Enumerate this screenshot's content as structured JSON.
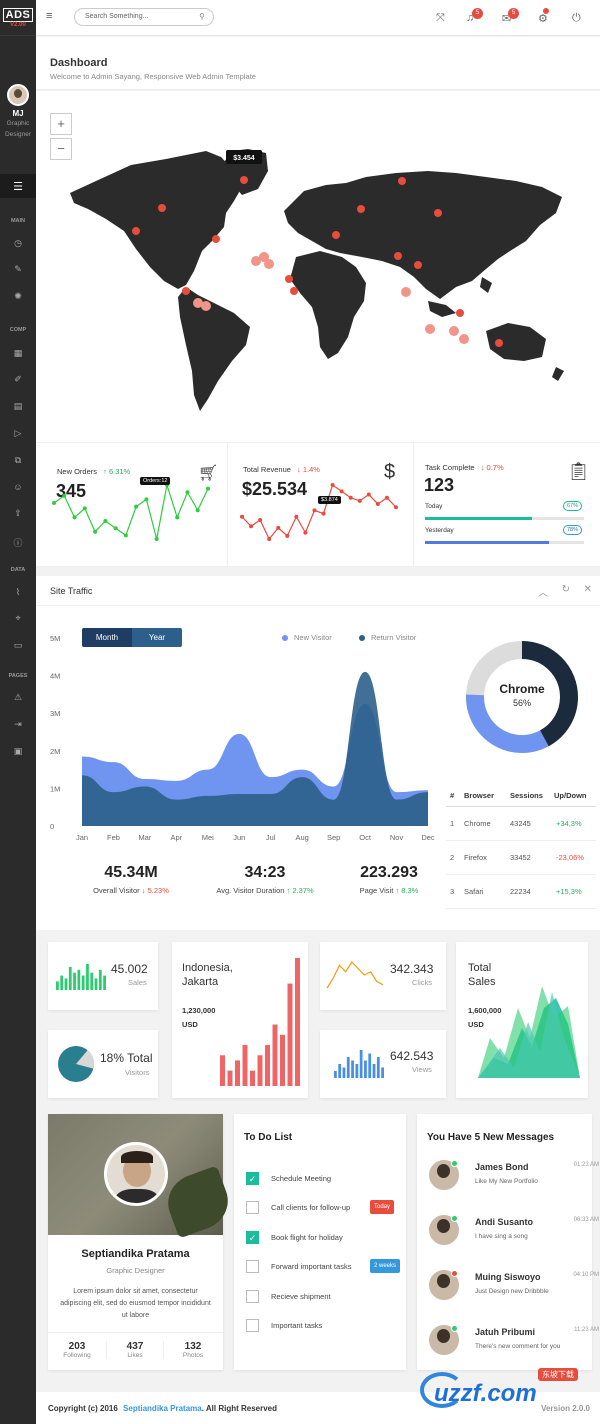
{
  "brand": {
    "name": "ADS",
    "version": "V2.00"
  },
  "user": {
    "initials": "MJ",
    "role_line1": "Graphic",
    "role_line2": "Designer"
  },
  "sidebar": {
    "sections": [
      "MAIN",
      "COMP",
      "DATA",
      "PAGES"
    ],
    "icons": [
      "menu-icon",
      "dashboard-icon",
      "brush-icon",
      "palette-icon",
      "grid-icon",
      "edit-icon",
      "table-icon",
      "play-icon",
      "copy-icon",
      "smile-icon",
      "upload-icon",
      "info-icon",
      "chart-line-icon",
      "map-pin-icon",
      "monitor-icon",
      "warning-icon",
      "login-icon",
      "desktop-icon"
    ]
  },
  "topbar": {
    "search_placeholder": "Search Something...",
    "notification_count": "5",
    "message_count": "5"
  },
  "header": {
    "title": "Dashboard",
    "subtitle": "Welcome to Admin Sayang, Responsive Web Admin Template"
  },
  "map": {
    "tooltip": "$3.454",
    "zoom_in": "+",
    "zoom_out": "−"
  },
  "stats": {
    "orders": {
      "label": "New Orders",
      "change": "↑ 6.31%",
      "value": "345",
      "tooltip": "Orders:12",
      "spark": [
        38,
        42,
        30,
        35,
        22,
        28,
        24,
        20,
        36,
        40,
        18,
        48,
        30,
        44,
        34,
        46
      ]
    },
    "revenue": {
      "label": "Total Revenue",
      "change": "↓ 1.4%",
      "value": "$25.534",
      "tooltip": "$3.874",
      "spark": [
        32,
        26,
        30,
        18,
        25,
        20,
        32,
        22,
        36,
        34,
        52,
        48,
        44,
        42,
        46,
        40,
        44,
        38
      ]
    },
    "tasks": {
      "label": "Task Complete",
      "change": "↓ 0.7%",
      "value": "123",
      "today_label": "Today",
      "today_pct": "67%",
      "today_value": 67,
      "yesterday_label": "Yesterday",
      "yesterday_pct": "78%",
      "yesterday_value": 78
    }
  },
  "traffic": {
    "title": "Site Traffic",
    "tabs": [
      "Month",
      "Year"
    ],
    "legend": {
      "new": "New Visitor",
      "return": "Return Visitor"
    },
    "y_ticks": [
      "5M",
      "4M",
      "3M",
      "2M",
      "1M",
      "0"
    ],
    "months": [
      "Jan",
      "Feb",
      "Mar",
      "Apr",
      "Mei",
      "Jun",
      "Jul",
      "Aug",
      "Sep",
      "Oct",
      "Nov",
      "Dec"
    ],
    "donut": {
      "label": "Chrome",
      "pct": "56%",
      "value": 56
    },
    "kpis": [
      {
        "value": "45.34M",
        "label": "Overall Visitor",
        "change": "↓ 5.23%",
        "dir": "dn"
      },
      {
        "value": "34:23",
        "label": "Avg. Visitor Duration",
        "change": "↑ 2.37%",
        "dir": "up"
      },
      {
        "value": "223.293",
        "label": "Page Visit",
        "change": "↑ 8.3%",
        "dir": "up"
      }
    ],
    "table": {
      "headers": [
        "#",
        "Browser",
        "Sessions",
        "Up/Down"
      ],
      "rows": [
        {
          "n": "1",
          "browser": "Chrome",
          "sessions": "43245",
          "delta": "+34,3%",
          "dir": "up"
        },
        {
          "n": "2",
          "browser": "Firefox",
          "sessions": "33452",
          "delta": "-23,06%",
          "dir": "dn"
        },
        {
          "n": "3",
          "browser": "Safari",
          "sessions": "22234",
          "delta": "+15,3%",
          "dir": "up"
        }
      ]
    }
  },
  "chart_data": [
    {
      "type": "area",
      "x": [
        "Jan",
        "Feb",
        "Mar",
        "Apr",
        "Mei",
        "Jun",
        "Jul",
        "Aug",
        "Sep",
        "Oct",
        "Nov",
        "Dec"
      ],
      "ylim": [
        0,
        5000000
      ],
      "y_ticks": [
        "5M",
        "4M",
        "3M",
        "2M",
        "1M",
        "0"
      ],
      "series": [
        {
          "name": "New Visitor",
          "color": "#6f95f0",
          "values": [
            1850000,
            1700000,
            1250000,
            1200000,
            1500000,
            2450000,
            1300000,
            1500000,
            1050000,
            3250000,
            900000,
            950000
          ]
        },
        {
          "name": "Return Visitor",
          "color": "#2c5f8a",
          "values": [
            1350000,
            900000,
            1050000,
            700000,
            800000,
            850000,
            850000,
            1300000,
            700000,
            4100000,
            700000,
            900000
          ]
        }
      ]
    },
    {
      "type": "pie",
      "categories": [
        "Chrome"
      ],
      "values": [
        56
      ]
    }
  ],
  "mini": {
    "sales": {
      "value": "45.002",
      "label": "Sales",
      "bars": [
        3,
        5,
        4,
        8,
        6,
        7,
        5,
        9,
        6,
        4,
        7,
        5
      ]
    },
    "visitors": {
      "value": "18% Total",
      "label": "Visitors",
      "pct": 18
    },
    "jakarta": {
      "city": "Indonesia,",
      "city2": "Jakarta",
      "amount": "1,230,000",
      "currency": "USD",
      "bars": [
        6,
        3,
        5,
        8,
        3,
        6,
        8,
        12,
        10,
        20,
        25
      ]
    },
    "clicks": {
      "value": "342.343",
      "label": "Clicks",
      "spark": [
        20,
        14,
        6,
        10,
        4,
        8,
        12,
        10,
        16,
        18
      ]
    },
    "views": {
      "value": "642.543",
      "label": "Views",
      "bars": [
        2,
        4,
        3,
        6,
        5,
        4,
        8,
        5,
        7,
        4,
        6,
        3
      ]
    },
    "total_sales": {
      "title1": "Total",
      "title2": "Sales",
      "amount": "1,600,000",
      "currency": "USD"
    }
  },
  "profile_card": {
    "name": "Septiandika Pratama",
    "role": "Graphic Designer",
    "bio": "Lorem ipsum dolor sit amet, consectetur adipiscing elit, sed do eiusmod tempor incididunt ut labore",
    "stats": [
      {
        "v": "203",
        "l": "Following"
      },
      {
        "v": "437",
        "l": "Likes"
      },
      {
        "v": "132",
        "l": "Photos"
      }
    ]
  },
  "todo": {
    "title": "To Do List",
    "items": [
      {
        "text": "Schedule Meeting",
        "done": true
      },
      {
        "text": "Call clients for follow-up",
        "done": false,
        "tag": "Today",
        "tag_color": "#e74c3c"
      },
      {
        "text": "Book flight for holiday",
        "done": true
      },
      {
        "text": "Forward important tasks",
        "done": false,
        "tag": "2 weeks",
        "tag_color": "#3498db"
      },
      {
        "text": "Recieve shipment",
        "done": false
      },
      {
        "text": "Important tasks",
        "done": false
      }
    ]
  },
  "messages": {
    "title": "You Have 5 New Messages",
    "items": [
      {
        "name": "James Bond",
        "text": "Like My New Portfolio",
        "time": "01:23 AM",
        "status": "#2ecc71"
      },
      {
        "name": "Andi Susanto",
        "text": "I have sing a song",
        "time": "06:33 AM",
        "status": "#2ecc71"
      },
      {
        "name": "Muing Siswoyo",
        "text": "Just Design new Dribbble",
        "time": "04:10 PM",
        "status": "#e74c3c"
      },
      {
        "name": "Jatuh Pribumi",
        "text": "There's new comment for you",
        "time": "11:23 AM",
        "status": "#2ecc71"
      }
    ]
  },
  "footer": {
    "prefix": "Copyright (c) 2016",
    "author": "Septiandika Pratama",
    "suffix": ". All Right Reserved",
    "version": "Version 2.0.0"
  },
  "watermark": {
    "text": "uzzf.com",
    "tag": "东坡下载"
  }
}
